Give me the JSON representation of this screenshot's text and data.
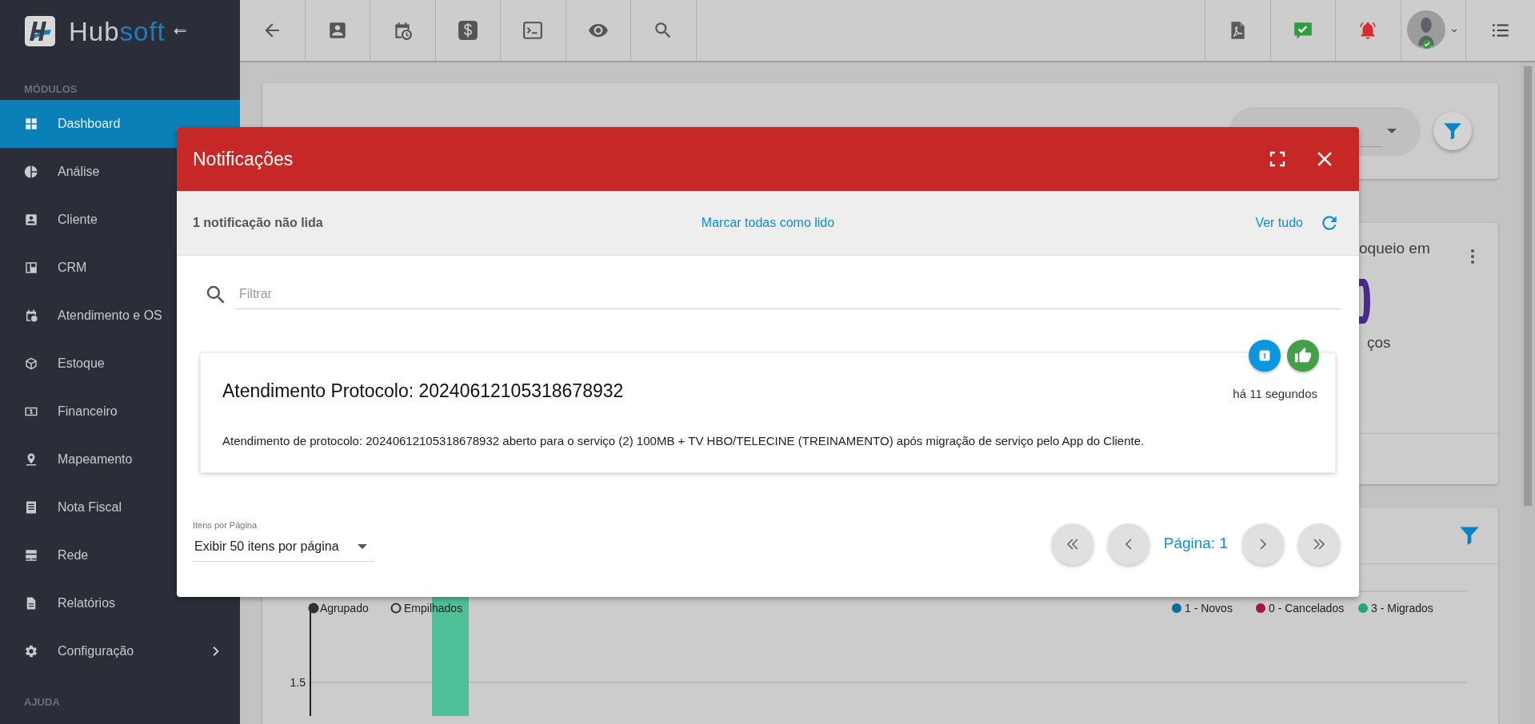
{
  "logo": {
    "parts": [
      "Hub",
      "soft"
    ]
  },
  "sidebar": {
    "sections": [
      {
        "heading": "MÓDULOS",
        "items": [
          {
            "label": "Dashboard",
            "selected": true,
            "has_submenu": false
          },
          {
            "label": "Análise",
            "selected": false,
            "has_submenu": false
          },
          {
            "label": "Cliente",
            "selected": false,
            "has_submenu": false
          },
          {
            "label": "CRM",
            "selected": false,
            "has_submenu": false
          },
          {
            "label": "Atendimento e OS",
            "selected": false,
            "has_submenu": false
          },
          {
            "label": "Estoque",
            "selected": false,
            "has_submenu": false
          },
          {
            "label": "Financeiro",
            "selected": false,
            "has_submenu": false
          },
          {
            "label": "Mapeamento",
            "selected": false,
            "has_submenu": false
          },
          {
            "label": "Nota Fiscal",
            "selected": false,
            "has_submenu": false
          },
          {
            "label": "Rede",
            "selected": false,
            "has_submenu": false
          },
          {
            "label": "Relatórios",
            "selected": false,
            "has_submenu": false
          },
          {
            "label": "Configuração",
            "selected": false,
            "has_submenu": true
          }
        ]
      },
      {
        "heading": "AJUDA"
      }
    ]
  },
  "background": {
    "card2": {
      "heading_fragment": "oqueio em",
      "caption_fragment": "ços"
    },
    "chart": {
      "modes": [
        {
          "label": "Agrupado",
          "selected": true
        },
        {
          "label": "Empilhados",
          "selected": false
        }
      ],
      "series": [
        {
          "name": "1 - Novos",
          "color": "#0e6b9e"
        },
        {
          "name": "0 - Cancelados",
          "color": "#9e1846"
        },
        {
          "name": "3 - Migrados",
          "color": "#1fa878"
        }
      ],
      "tick": "1.5"
    }
  },
  "modal": {
    "title": "Notificações",
    "unread": "1 notificação não lida",
    "mark_all": "Marcar todas como lido",
    "view_all": "Ver tudo",
    "filter": {
      "placeholder": "Filtrar"
    },
    "notifications": [
      {
        "title": "Atendimento Protocolo: 20240612105318678932",
        "time": "há 11 segundos",
        "body": "Atendimento de protocolo: 20240612105318678932 aberto para o serviço (2) 100MB + TV HBO/TELECINE (TREINAMENTO) após migração de serviço pelo App do Cliente."
      }
    ],
    "per_page_label": "Itens por Página",
    "per_page_value": "Exibir 50 itens por página",
    "page": "Página: 1"
  }
}
